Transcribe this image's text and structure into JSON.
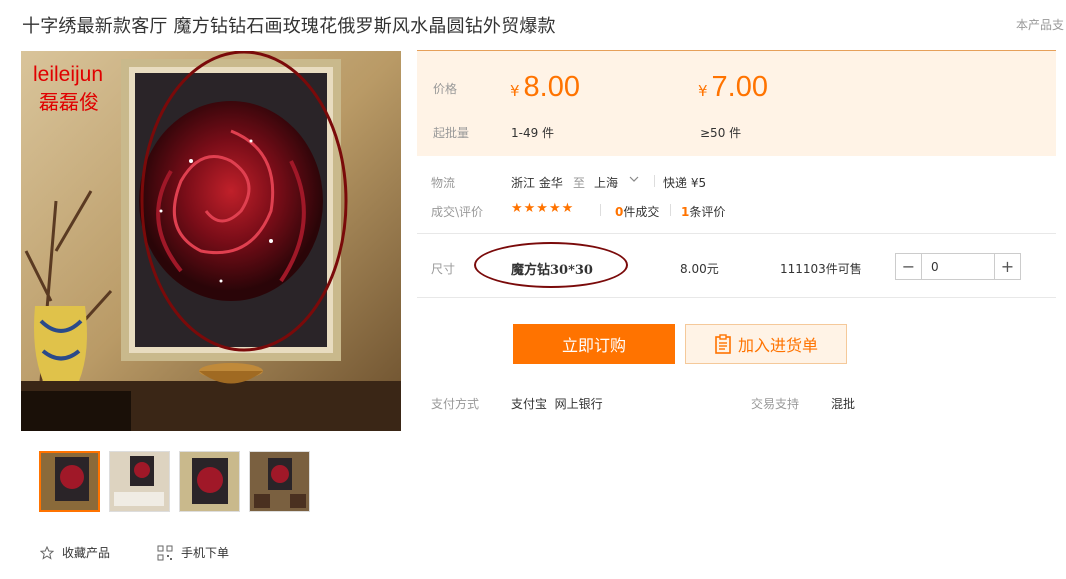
{
  "product": {
    "title": "十字绣最新款客厅 魔方钻钻石画玫瑰花俄罗斯风水晶圆钻外贸爆款",
    "support_text": "本产品支",
    "watermark_en": "leileijun",
    "watermark_cn": "磊磊俊"
  },
  "price_box": {
    "price_label": "价格",
    "batch_label": "起批量",
    "currency": "¥",
    "tiers": [
      {
        "price": "8.00",
        "batch": "1-49 件"
      },
      {
        "price": "7.00",
        "batch": "≥50 件"
      }
    ]
  },
  "logistics": {
    "label": "物流",
    "from": "浙江 金华",
    "to_word": "至",
    "to": "上海",
    "express": "快递 ¥5"
  },
  "deals": {
    "label": "成交\\评价",
    "rating_stars": 5,
    "stars_text": "★★★★★",
    "deals_count": "0",
    "deals_suffix": "件成交",
    "reviews_count": "1",
    "reviews_suffix": "条评价"
  },
  "size": {
    "label": "尺寸",
    "name": "魔方钻30*30",
    "price": "8.00元",
    "stock": "111103件可售",
    "quantity": "0",
    "minus": "−",
    "plus": "+"
  },
  "actions": {
    "buy_label": "立即订购",
    "cart_label": "加入进货单"
  },
  "payment": {
    "label": "支付方式",
    "methods": "支付宝  网上银行",
    "trade_label": "交易支持",
    "trade_value": "混批"
  },
  "bottom": {
    "favorite_label": "收藏产品",
    "mobile_label": "手机下单"
  },
  "thumbnails": [
    "thumb-1",
    "thumb-2",
    "thumb-3",
    "thumb-4"
  ],
  "colors": {
    "accent": "#ff7300",
    "price_bg": "#fff3e6",
    "annotation": "#7a0a0a"
  },
  "icons": [
    "star-outline-icon",
    "qr-code-icon",
    "clipboard-icon",
    "chevron-down-icon"
  ]
}
